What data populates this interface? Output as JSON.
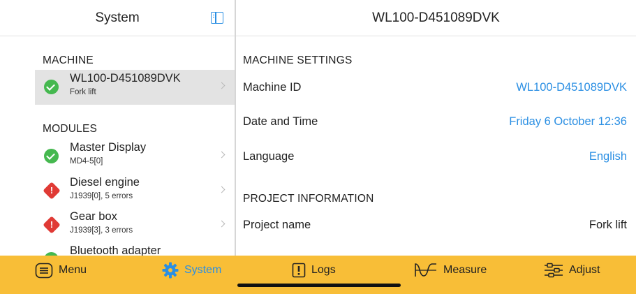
{
  "left": {
    "header_title": "System",
    "machine_section": "MACHINE",
    "machine": {
      "title": "WL100-D451089DVK",
      "subtitle": "Fork lift",
      "status": "ok"
    },
    "modules_section": "MODULES",
    "modules": [
      {
        "title": "Master Display",
        "subtitle": "MD4-5[0]",
        "status": "ok"
      },
      {
        "title": "Diesel engine",
        "subtitle": "J1939[0], 5 errors",
        "status": "error"
      },
      {
        "title": "Gear box",
        "subtitle": "J1939[3], 3 errors",
        "status": "error"
      },
      {
        "title": "Bluetooth adapter",
        "subtitle": "",
        "status": "ok"
      }
    ]
  },
  "right": {
    "header_title": "WL100-D451089DVK",
    "machine_settings_section": "MACHINE SETTINGS",
    "machine_id_label": "Machine ID",
    "machine_id_value": "WL100-D451089DVK",
    "date_time_label": "Date and Time",
    "date_time_value": "Friday 6 October 12:36",
    "language_label": "Language",
    "language_value": "English",
    "project_info_section": "PROJECT INFORMATION",
    "project_name_label": "Project name",
    "project_name_value": "Fork lift"
  },
  "tabbar": {
    "menu": "Menu",
    "system": "System",
    "logs": "Logs",
    "measure": "Measure",
    "adjust": "Adjust",
    "active": "system"
  },
  "colors": {
    "accent": "#2b8fe3",
    "tabbar_bg": "#f8be37",
    "ok": "#45b84f",
    "error": "#e03a35",
    "selected_row": "#e3e3e3"
  }
}
